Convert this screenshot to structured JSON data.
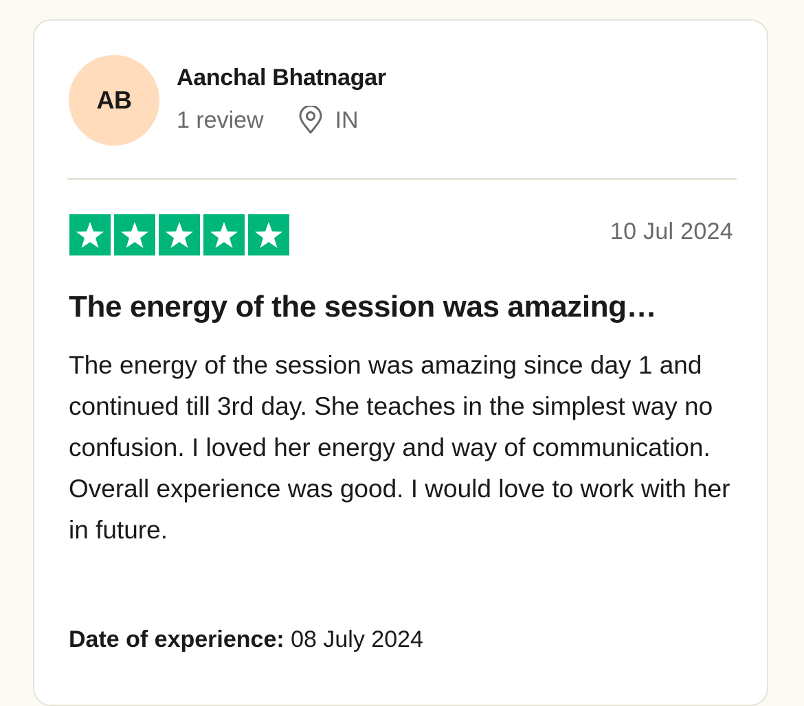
{
  "reviewer": {
    "initials": "AB",
    "name": "Aanchal Bhatnagar",
    "review_count": "1 review",
    "location_icon": "location-pin-icon",
    "country": "IN"
  },
  "review": {
    "rating": 5,
    "rating_max": 5,
    "star_icon": "star-icon",
    "date": "10 Jul 2024",
    "title": "The energy of the session was amazing…",
    "body": "The energy of the session was amazing since day 1 and continued till 3rd day. She teaches in the simplest way no confusion. I loved her energy and way of communication. Overall experience was good. I would love to work with her in future.",
    "experience_label": "Date of experience:",
    "experience_date": "08 July 2024"
  },
  "colors": {
    "page_background": "#fbfaf3",
    "card_background": "#ffffff",
    "avatar_background": "#ffdcbc",
    "star_green": "#00b67a",
    "text_primary": "#1a1a1a",
    "text_secondary": "#696a6a",
    "divider": "#e6e3d8"
  }
}
